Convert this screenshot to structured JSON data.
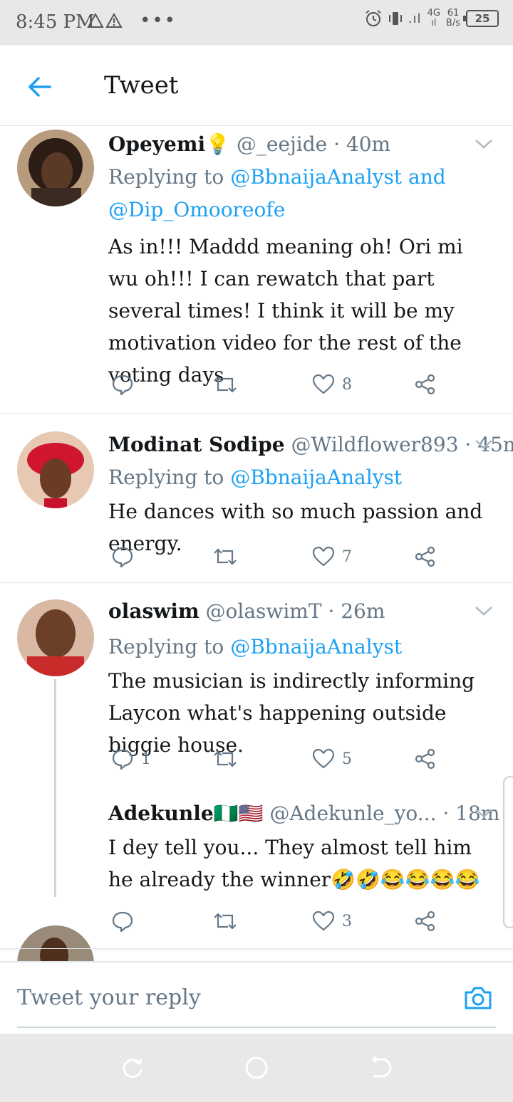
{
  "status_bar": {
    "time": "8:45 PM",
    "net_speed": "61",
    "net_unit": "B/s",
    "network_type": "4G",
    "battery": "25"
  },
  "header": {
    "title": "Tweet"
  },
  "tweets": [
    {
      "name": "Opeyemi",
      "name_emoji": "💡",
      "handle": "@_eejide",
      "time": "· 40m",
      "replying_prefix": "Replying to",
      "replying_to_1": "@BbnaijaAnalyst",
      "replying_and": "and",
      "replying_to_2": "@Dip_Omooreofe",
      "text": "As in!!! Maddd meaning oh! Ori mi wu oh!!! I can rewatch that part several times! I think it will be my motivation video for the rest of the voting days",
      "reply_count": "",
      "retweet_count": "",
      "like_count": "8"
    },
    {
      "name": "Modinat Sodipe",
      "handle": "@Wildflower893",
      "time": "· 45m",
      "replying_prefix": "Replying to",
      "replying_to_1": "@BbnaijaAnalyst",
      "text": "He dances with so much passion and energy.",
      "reply_count": "",
      "retweet_count": "",
      "like_count": "7"
    },
    {
      "name": "olaswim",
      "handle": "@olaswimT",
      "time": "· 26m",
      "replying_prefix": "Replying to",
      "replying_to_1": "@BbnaijaAnalyst",
      "text": "The musician is indirectly informing Laycon what's happening outside biggie house.",
      "reply_count": "1",
      "retweet_count": "",
      "like_count": "5"
    },
    {
      "name": "Adekunle",
      "name_emoji": "🇳🇬🇺🇸",
      "handle": "@Adekunle_yo...",
      "time": "· 18m",
      "text": "I dey tell you... They almost tell him he already the winner🤣🤣😂😂😂😂",
      "reply_count": "",
      "retweet_count": "",
      "like_count": "3"
    }
  ],
  "reply_bar": {
    "placeholder": "Tweet your reply"
  },
  "colors": {
    "accent": "#1da1f2",
    "secondary_text": "#657786",
    "divider": "#e1e8ed"
  },
  "icons": [
    "back-arrow-icon",
    "chevron-down-icon",
    "reply-icon",
    "retweet-icon",
    "heart-icon",
    "share-icon",
    "camera-icon",
    "alarm-icon",
    "battery-icon"
  ]
}
